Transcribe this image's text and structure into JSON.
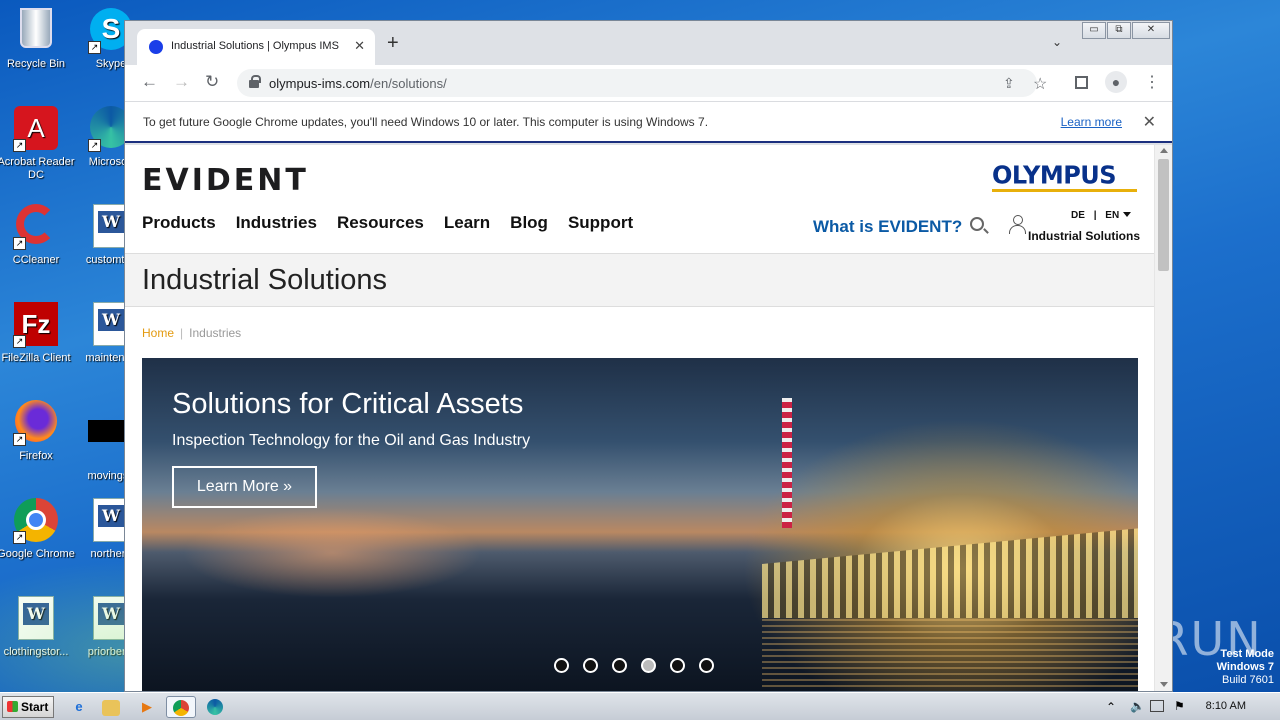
{
  "desktop": {
    "icons": [
      {
        "label": "Recycle Bin",
        "icon": "recycle-bin-icon"
      },
      {
        "label": "Acrobat Reader DC",
        "icon": "acrobat-icon"
      },
      {
        "label": "CCleaner",
        "icon": "ccleaner-icon"
      },
      {
        "label": "FileZilla Client",
        "icon": "filezilla-icon"
      },
      {
        "label": "Firefox",
        "icon": "firefox-icon"
      },
      {
        "label": "Google Chrome",
        "icon": "chrome-icon"
      },
      {
        "label": "clothingstor...",
        "icon": "word-doc-icon"
      },
      {
        "label": "Skype",
        "icon": "skype-icon"
      },
      {
        "label": "Microsoft",
        "icon": "edge-icon"
      },
      {
        "label": "customtes",
        "icon": "word-doc-icon"
      },
      {
        "label": "maintenan",
        "icon": "word-doc-icon"
      },
      {
        "label": "movingsu",
        "icon": "black-file-icon"
      },
      {
        "label": "northern",
        "icon": "word-doc-icon"
      },
      {
        "label": "priorbene",
        "icon": "word-doc-icon"
      }
    ],
    "watermark": "ANY RUN",
    "test_mode": {
      "line1": "Test Mode",
      "line2": "Windows 7",
      "line3": "Build 7601"
    }
  },
  "browser": {
    "tab_title": "Industrial Solutions | Olympus IMS",
    "tab_close": "✕",
    "new_tab": "+",
    "url_host": "olympus-ims.com",
    "url_path": "/en/solutions/",
    "window_controls": {
      "minimize": "▭",
      "restore": "⧉",
      "close": "✕"
    },
    "infobar": {
      "message": "To get future Google Chrome updates, you'll need Windows 10 or later. This computer is using Windows 7.",
      "link": "Learn more",
      "close": "✕"
    }
  },
  "site": {
    "logo_left": "EVIDENT",
    "logo_right": "OLYMPUS",
    "nav": [
      "Products",
      "Industries",
      "Resources",
      "Learn",
      "Blog",
      "Support"
    ],
    "what_is": "What is EVIDENT?",
    "lang_de": "DE",
    "lang_sep": "|",
    "lang_en": "EN",
    "account_label": "Industrial Solutions",
    "page_title": "Industrial Solutions",
    "breadcrumb": {
      "home": "Home",
      "sep": "|",
      "current": "Industries"
    },
    "hero": {
      "title": "Solutions for Critical Assets",
      "subtitle": "Inspection Technology for the Oil and Gas Industry",
      "button": "Learn More »",
      "slide_count": 6,
      "active_slide": 4
    }
  },
  "taskbar": {
    "start": "Start",
    "apps": [
      "ie-icon",
      "explorer-icon",
      "media-player-icon",
      "chrome-icon",
      "edge-icon"
    ],
    "clock": "8:10 AM"
  }
}
